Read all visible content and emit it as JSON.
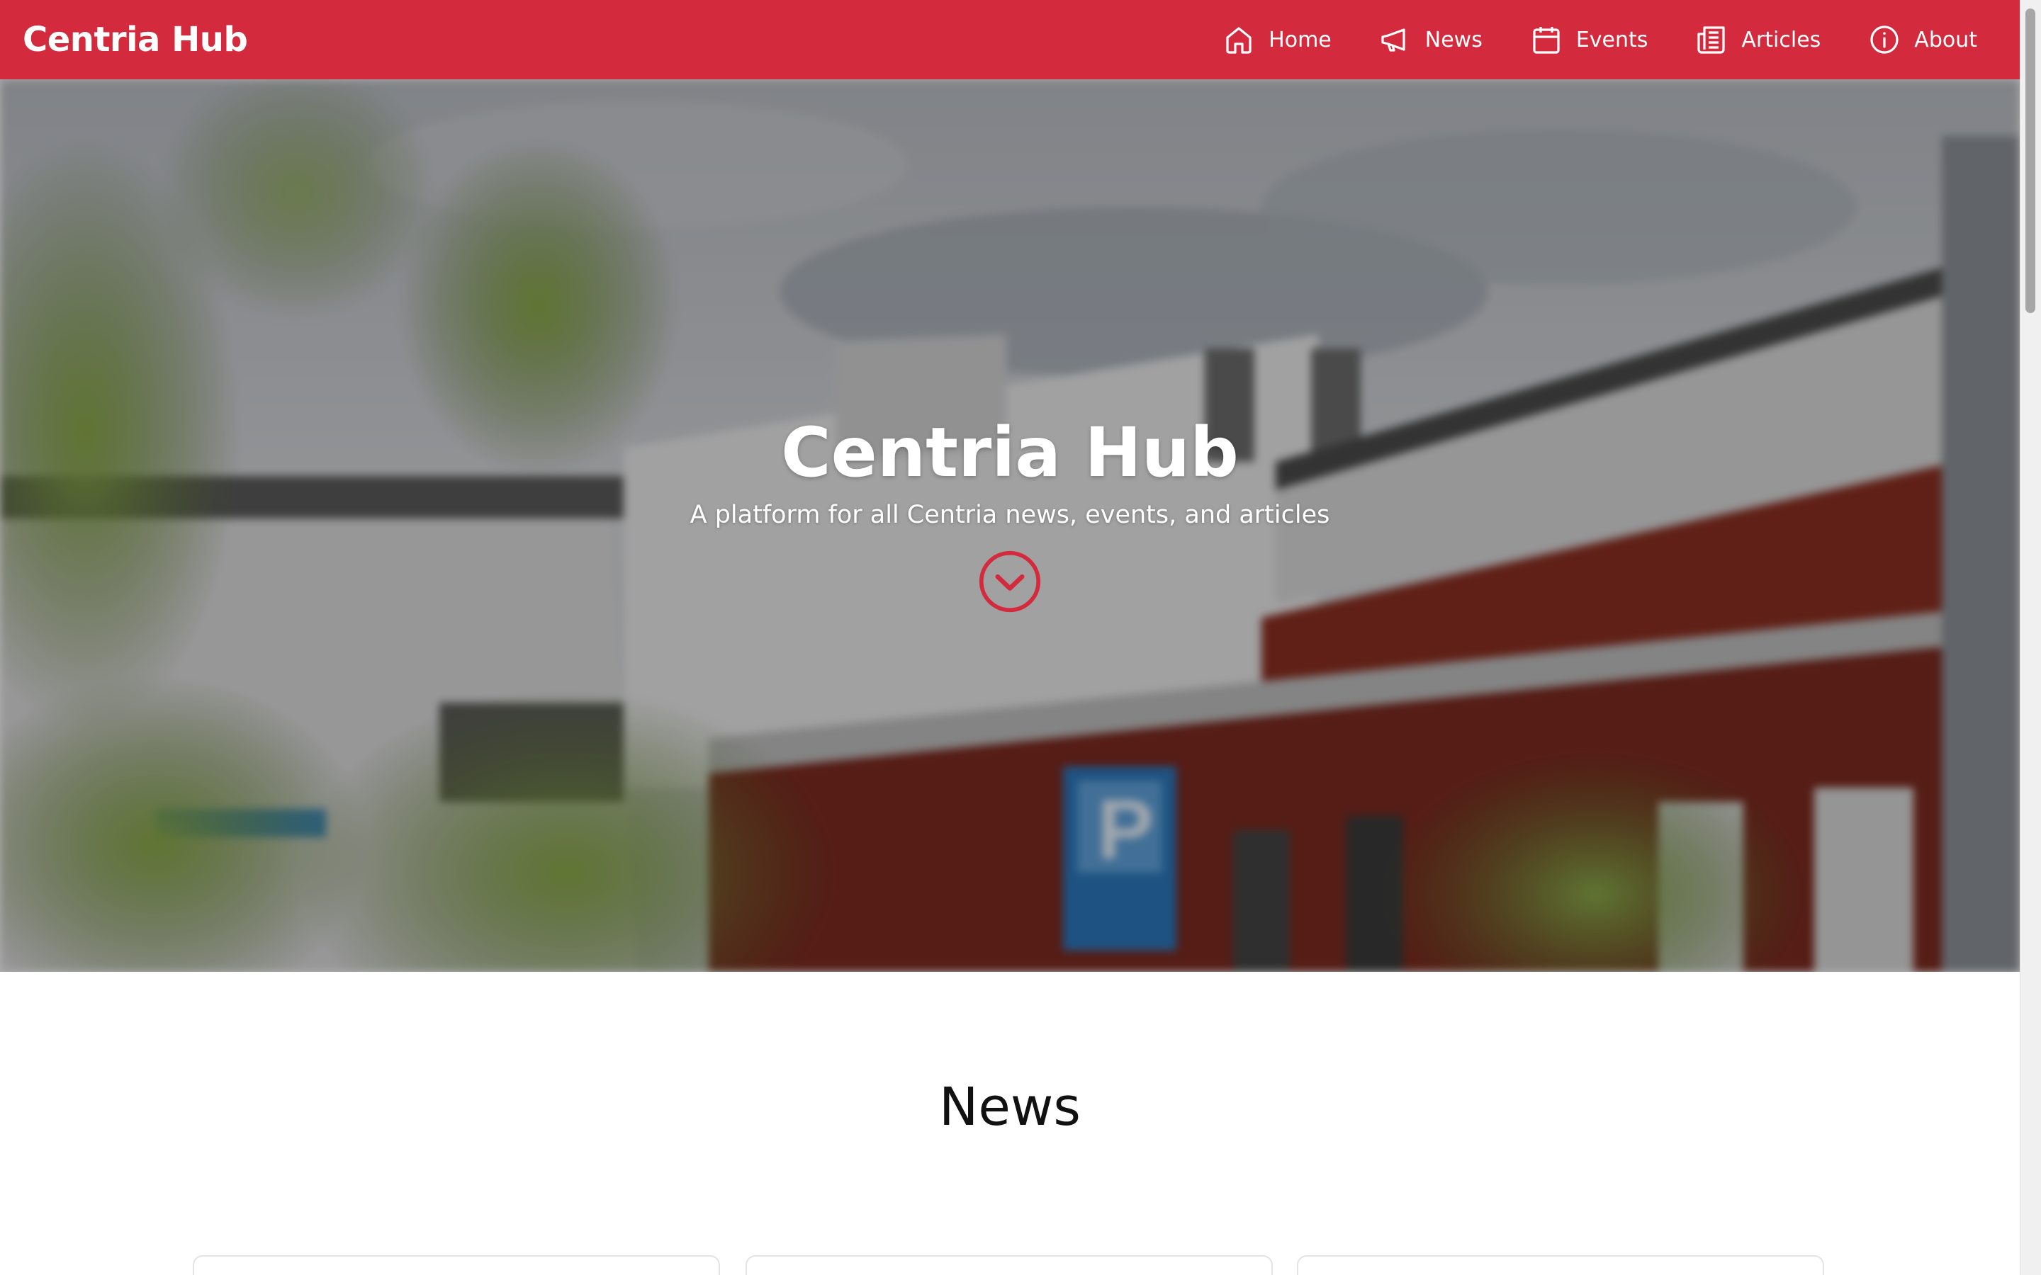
{
  "navbar": {
    "brand": "Centria Hub",
    "links": [
      {
        "label": "Home",
        "icon": "home-icon"
      },
      {
        "label": "News",
        "icon": "megaphone-icon"
      },
      {
        "label": "Events",
        "icon": "calendar-icon"
      },
      {
        "label": "Articles",
        "icon": "newspaper-icon"
      },
      {
        "label": "About",
        "icon": "info-icon"
      }
    ]
  },
  "hero": {
    "title": "Centria Hub",
    "subtitle": "A platform for all Centria news, events, and articles",
    "scroll_icon": "chevron-down-circle-icon"
  },
  "news": {
    "title": "News",
    "card_count_visible": 3
  },
  "colors": {
    "brand_red": "#d32a3d",
    "white": "#ffffff",
    "text_dark": "#111111"
  }
}
